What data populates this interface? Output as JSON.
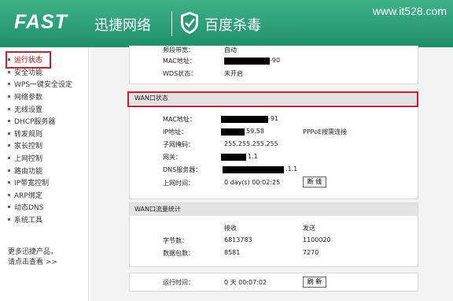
{
  "header": {
    "brand": "FAST",
    "brand_cn": "迅捷网络",
    "partner": "百度杀毒",
    "site": "www.it528.com"
  },
  "sidebar": {
    "items": [
      {
        "label": "运行状态"
      },
      {
        "label": "安全功能"
      },
      {
        "label": "WPS一键安全设定"
      },
      {
        "label": "网络参数"
      },
      {
        "label": "无线设置"
      },
      {
        "label": "DHCP服务器"
      },
      {
        "label": "转发规则"
      },
      {
        "label": "家长控制"
      },
      {
        "label": "上网控制"
      },
      {
        "label": "路由功能"
      },
      {
        "label": "IP带宽控制"
      },
      {
        "label": "ARP绑定"
      },
      {
        "label": "动态DNS"
      },
      {
        "label": "系统工具"
      }
    ],
    "more1": "更多迅捷产品，",
    "more2": "请点击查看 >>"
  },
  "wireless": {
    "bandwidth_label": "频段带宽：",
    "bandwidth_value": "自动",
    "mac_label": "MAC地址：",
    "mac_suffix": "-90",
    "wds_label": "WDS状态：",
    "wds_value": "未开启"
  },
  "wan": {
    "title": "WAN口状态",
    "mac_label": "MAC地址：",
    "mac_suffix": "-91",
    "ip_label": "IP地址：",
    "ip_suffix": "59.58",
    "conn_type": "PPPoE按需连接",
    "mask_label": "子网掩码：",
    "mask_value": "255.255.255.255",
    "gw_label": "网关：",
    "gw_suffix": "1.1",
    "dns_label": "DNS服务器：",
    "dns_suffix": ".1.1",
    "uptime_label": "上网时间：",
    "uptime_value": "0 day(s) 00:02:25",
    "disconnect_label": "断 线"
  },
  "traffic": {
    "title": "WAN口流量统计",
    "recv_header": "接收",
    "send_header": "发送",
    "bytes_label": "字节数：",
    "bytes_recv": "6813783",
    "bytes_send": "1100020",
    "packets_label": "数据包数：",
    "packets_recv": "8581",
    "packets_send": "7270"
  },
  "runtime": {
    "label": "运行时间：",
    "value": "0 天 00:07:02",
    "refresh_label": "刷 新"
  }
}
